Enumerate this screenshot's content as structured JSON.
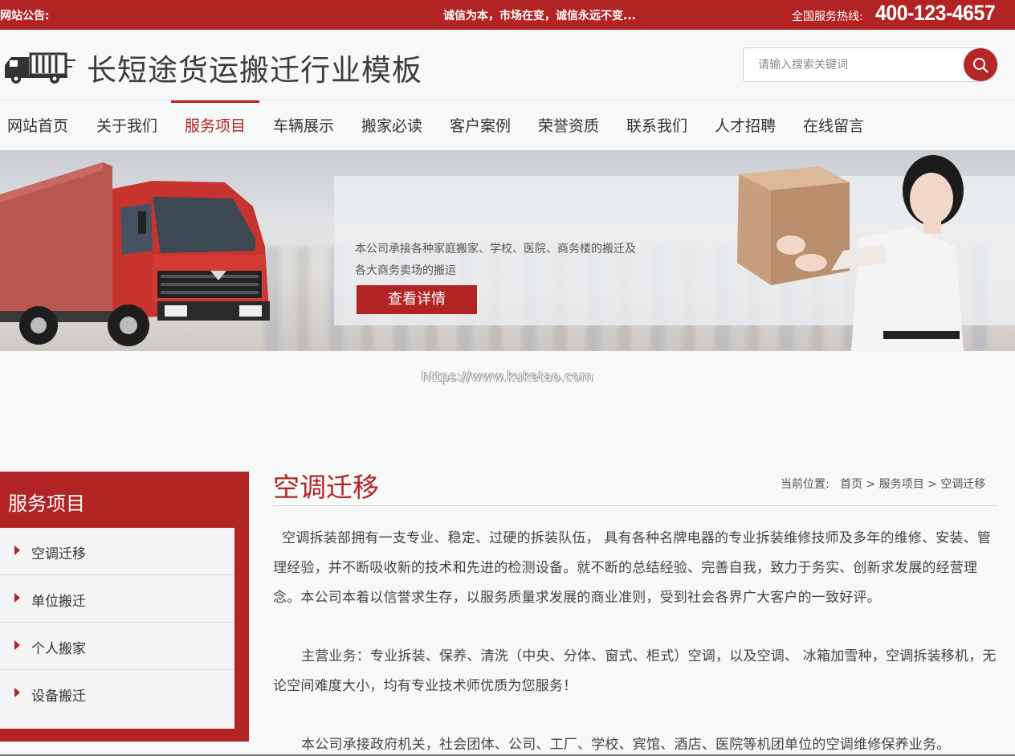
{
  "topbar": {
    "notice_label": "网站公告:",
    "slogan": "诚信为本，市场在变，诚信永远不变...",
    "hotline_label": "全国服务热线:",
    "hotline_number": "400-123-4657"
  },
  "header": {
    "site_title": "长短途货运搬迁行业模板",
    "search_placeholder": "请输入搜索关键词"
  },
  "nav": {
    "items": [
      {
        "label": "网站首页"
      },
      {
        "label": "关于我们"
      },
      {
        "label": "服务项目"
      },
      {
        "label": "车辆展示"
      },
      {
        "label": "搬家必读"
      },
      {
        "label": "客户案例"
      },
      {
        "label": "荣誉资质"
      },
      {
        "label": "联系我们"
      },
      {
        "label": "人才招聘"
      },
      {
        "label": "在线留言"
      }
    ],
    "active_index": 2
  },
  "banner": {
    "text_line1": "本公司承接各种家庭搬家、学校、医院、商务楼的搬迁及",
    "text_line2": "各大商务卖场的搬运",
    "button_label": "查看详情"
  },
  "watermark": "https://www.kuketao.com",
  "sidebar": {
    "title": "服务项目",
    "items": [
      {
        "label": "空调迁移"
      },
      {
        "label": "单位搬迁"
      },
      {
        "label": "个人搬家"
      },
      {
        "label": "设备搬迁"
      }
    ]
  },
  "content": {
    "title": "空调迁移",
    "breadcrumb": {
      "prefix": "当前位置:",
      "items": [
        "首页",
        "服务项目",
        "空调迁移"
      ],
      "separator": ">"
    },
    "paragraphs": [
      "  空调拆装部拥有一支专业、稳定、过硬的拆装队伍， 具有各种名牌电器的专业拆装维修技师及多年的维修、安装、管理经验，并不断吸收新的技术和先进的检测设备。就不断的总结经验、完善自我，致力于务实、创新求发展的经营理念。本公司本着以信誉求生存，以服务质量求发展的商业准则，受到社会各界广大客户的一致好评。",
      "主营业务：专业拆装、保养、清洗（中央、分体、窗式、柜式）空调，以及空调、 冰箱加雪种，空调拆装移机，无论空间难度大小，均有专业技术师优质为您服务！",
      "本公司承接政府机关，社会团体、公司、工厂、学校、宾馆、酒店、医院等机团单位的空调维修保养业务。"
    ]
  },
  "colors": {
    "brand_red": "#b22424",
    "background": "#f7f8f8",
    "text": "#333333"
  },
  "icons": {
    "logo": "truck-icon",
    "search": "search-icon",
    "sidebar_bullet": "triangle-right-icon"
  }
}
